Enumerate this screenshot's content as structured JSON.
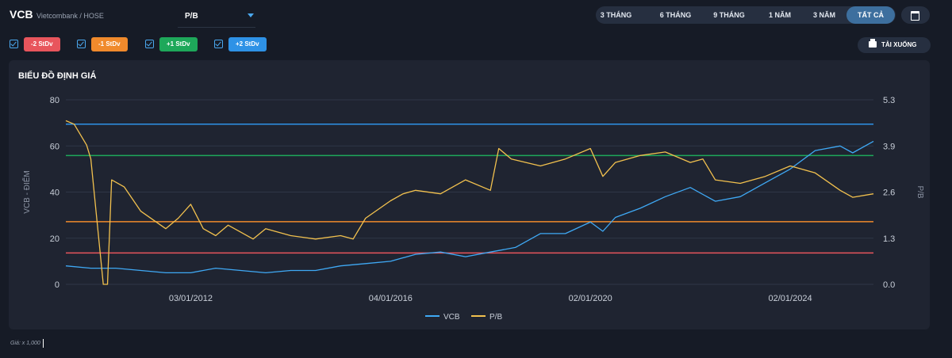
{
  "header": {
    "ticker": "VCB",
    "exchange": "Vietcombank / HOSE",
    "metric": "P/B",
    "ranges": [
      {
        "label": "3 THÁNG"
      },
      {
        "label": "6 THÁNG"
      },
      {
        "label": "9 THÁNG"
      },
      {
        "label": "1 NĂM"
      },
      {
        "label": "3 NĂM"
      },
      {
        "label": "TẤT CẢ"
      }
    ],
    "active_range": "TẤT CẢ"
  },
  "stdv": [
    {
      "label": "-2 StDv",
      "color": "#e8555c",
      "checked": true
    },
    {
      "label": "-1 StDv",
      "color": "#f08a2c",
      "checked": true
    },
    {
      "label": "+1 StDv",
      "color": "#1ea85a",
      "checked": true
    },
    {
      "label": "+2 StDv",
      "color": "#2e92e6",
      "checked": true
    }
  ],
  "download_label": "TẢI XUỐNG",
  "panel_title": "BIỂU ĐỒ ĐỊNH GIÁ",
  "footnote": "Giá: x 1,000",
  "chart_data": {
    "type": "line",
    "title": "",
    "ylabel": "VCB - ĐIỂM",
    "y2label": "P/B",
    "ylim": [
      0,
      80
    ],
    "y2lim": [
      0,
      5.3
    ],
    "yticks": [
      "0",
      "20",
      "40",
      "60",
      "80"
    ],
    "y2ticks": [
      "0.0",
      "1.3",
      "2.6",
      "3.9",
      "5.3"
    ],
    "xticks": [
      "03/01/2012",
      "04/01/2016",
      "02/01/2020",
      "02/01/2024"
    ],
    "x_range": [
      "2009-07",
      "2025-09"
    ],
    "legend_position": "bottom",
    "grid": true,
    "series": [
      {
        "name": "VCB",
        "axis": "left",
        "color": "#3fa9f5",
        "x": [
          "2009-07",
          "2010-01",
          "2010-07",
          "2011-01",
          "2011-07",
          "2012-01",
          "2012-07",
          "2013-01",
          "2013-07",
          "2014-01",
          "2014-07",
          "2015-01",
          "2015-07",
          "2016-01",
          "2016-07",
          "2017-01",
          "2017-07",
          "2018-01",
          "2018-04",
          "2018-07",
          "2019-01",
          "2019-07",
          "2020-01",
          "2020-04",
          "2020-07",
          "2021-01",
          "2021-07",
          "2022-01",
          "2022-07",
          "2023-01",
          "2023-07",
          "2024-01",
          "2024-07",
          "2025-01",
          "2025-04",
          "2025-09"
        ],
        "values": [
          8,
          7,
          7,
          6,
          5,
          5,
          7,
          6,
          5,
          6,
          6,
          8,
          9,
          10,
          13,
          14,
          12,
          14,
          15,
          16,
          22,
          22,
          27,
          23,
          29,
          33,
          38,
          42,
          36,
          38,
          44,
          50,
          58,
          60,
          57,
          62
        ]
      },
      {
        "name": "P/B",
        "axis": "right",
        "color": "#f2c14e",
        "x": [
          "2009-07",
          "2009-09",
          "2009-12",
          "2010-01",
          "2010-04",
          "2010-05",
          "2010-06",
          "2010-09",
          "2011-01",
          "2011-07",
          "2011-10",
          "2012-01",
          "2012-04",
          "2012-07",
          "2012-10",
          "2013-01",
          "2013-04",
          "2013-07",
          "2014-01",
          "2014-07",
          "2015-01",
          "2015-04",
          "2015-07",
          "2016-01",
          "2016-04",
          "2016-07",
          "2017-01",
          "2017-07",
          "2018-01",
          "2018-03",
          "2018-06",
          "2019-01",
          "2019-07",
          "2020-01",
          "2020-04",
          "2020-07",
          "2021-01",
          "2021-07",
          "2022-01",
          "2022-04",
          "2022-07",
          "2023-01",
          "2023-07",
          "2024-01",
          "2024-07",
          "2025-01",
          "2025-04",
          "2025-09"
        ],
        "values": [
          4.7,
          4.6,
          4.0,
          3.6,
          0.0,
          0.0,
          3.0,
          2.8,
          2.1,
          1.6,
          1.9,
          2.3,
          1.6,
          1.4,
          1.7,
          1.5,
          1.3,
          1.6,
          1.4,
          1.3,
          1.4,
          1.3,
          1.9,
          2.4,
          2.6,
          2.7,
          2.6,
          3.0,
          2.7,
          3.9,
          3.6,
          3.4,
          3.6,
          3.9,
          3.1,
          3.5,
          3.7,
          3.8,
          3.5,
          3.6,
          3.0,
          2.9,
          3.1,
          3.4,
          3.2,
          2.7,
          2.5,
          2.6
        ]
      }
    ],
    "reference_lines": [
      {
        "name": "+2 StDv",
        "axis": "right",
        "value": 4.6,
        "color": "#2e92e6"
      },
      {
        "name": "+1 StDv",
        "axis": "right",
        "value": 3.7,
        "color": "#1ea85a"
      },
      {
        "name": "-1 StDv",
        "axis": "right",
        "value": 1.8,
        "color": "#f08a2c"
      },
      {
        "name": "-2 StDv",
        "axis": "right",
        "value": 0.9,
        "color": "#e8555c"
      }
    ]
  }
}
